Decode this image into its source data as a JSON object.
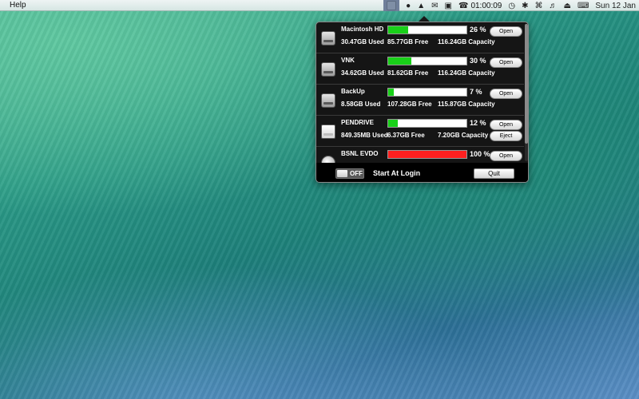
{
  "menubar": {
    "help_label": "Help",
    "clock": "01:00:09",
    "date": "Sun 12 Jan"
  },
  "drives": [
    {
      "name": "Macintosh HD",
      "used": "30.47GB Used",
      "free": "85.77GB Free",
      "capacity": "116.24GB Capacity",
      "percent_label": "26 %",
      "percent": 26,
      "bar_color": "#19d019",
      "icon": "hard-disk-icon",
      "open_label": "Open"
    },
    {
      "name": "VNK",
      "used": "34.62GB Used",
      "free": "81.62GB Free",
      "capacity": "116.24GB Capacity",
      "percent_label": "30 %",
      "percent": 30,
      "bar_color": "#19d019",
      "icon": "hard-disk-icon",
      "open_label": "Open"
    },
    {
      "name": "BackUp",
      "used": "8.58GB Used",
      "free": "107.28GB Free",
      "capacity": "115.87GB Capacity",
      "percent_label": "7 %",
      "percent": 7,
      "bar_color": "#19d019",
      "icon": "hard-disk-icon",
      "open_label": "Open"
    },
    {
      "name": "PENDRIVE",
      "used": "849.35MB Used",
      "free": "6.37GB Free",
      "capacity": "7.20GB Capacity",
      "percent_label": "12 %",
      "percent": 12,
      "bar_color": "#19d019",
      "icon": "usb-drive-icon",
      "open_label": "Open",
      "eject_label": "Eject"
    },
    {
      "name": "BSNL EVDO",
      "used": "",
      "free": "",
      "capacity": "",
      "percent_label": "100 %",
      "percent": 100,
      "bar_color": "#ff2020",
      "icon": "network-volume-icon",
      "open_label": "Open"
    }
  ],
  "footer": {
    "toggle_label": "OFF",
    "login_label": "Start At Login",
    "quit_label": "Quit"
  }
}
